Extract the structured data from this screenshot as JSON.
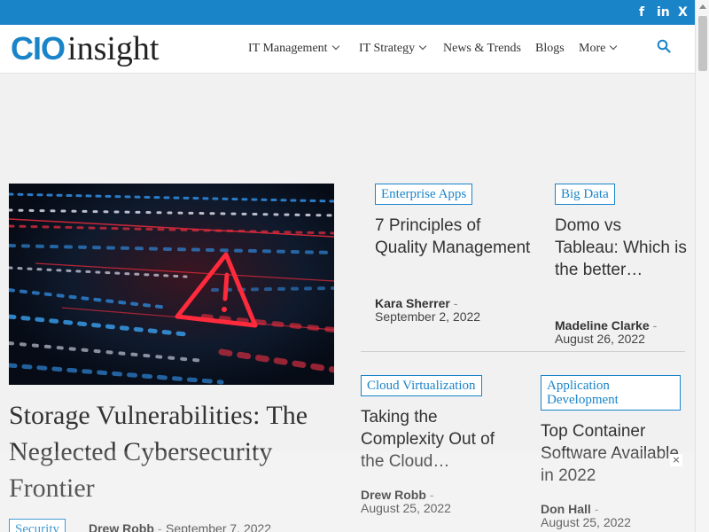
{
  "topbar": {
    "social": [
      {
        "icon": "facebook-icon",
        "label": "f"
      },
      {
        "icon": "linkedin-icon",
        "label": "in"
      },
      {
        "icon": "x-icon",
        "label": "X"
      }
    ]
  },
  "header": {
    "logo": {
      "part1": "CIO",
      "part2": "insight"
    },
    "nav": [
      {
        "label": "IT Management",
        "dropdown": true
      },
      {
        "label": "IT Strategy",
        "dropdown": true
      },
      {
        "label": "News & Trends",
        "dropdown": false
      },
      {
        "label": "Blogs",
        "dropdown": false
      },
      {
        "label": "More",
        "dropdown": true
      }
    ]
  },
  "hero": {
    "title": "Storage Vulnerabilities: The Neglected Cybersecurity Frontier",
    "tag": "Security",
    "author": "Drew Robb",
    "date": "September 7, 2022"
  },
  "cards": [
    {
      "tag": "Enterprise Apps",
      "title": "7 Principles of Quality Management",
      "author": "Kara Sherrer",
      "date": "September 2, 2022"
    },
    {
      "tag": "Big Data",
      "title": "Domo vs Tableau: Which is the better…",
      "author": "Madeline Clarke",
      "date": "August 26, 2022"
    },
    {
      "tag": "Cloud Virtualization",
      "title": "Taking the Complexity Out of the Cloud…",
      "author": "Drew Robb",
      "date": "August 25, 2022"
    },
    {
      "tag": "Application Development",
      "title": "Top Container Software Available in 2022",
      "author": "Don Hall",
      "date": "August 25, 2022"
    }
  ],
  "meta_separator": "-",
  "overlay": {
    "close_label": "×"
  },
  "colors": {
    "brand": "#1a84c9",
    "background": "#f1f1f1",
    "text": "#333333"
  }
}
